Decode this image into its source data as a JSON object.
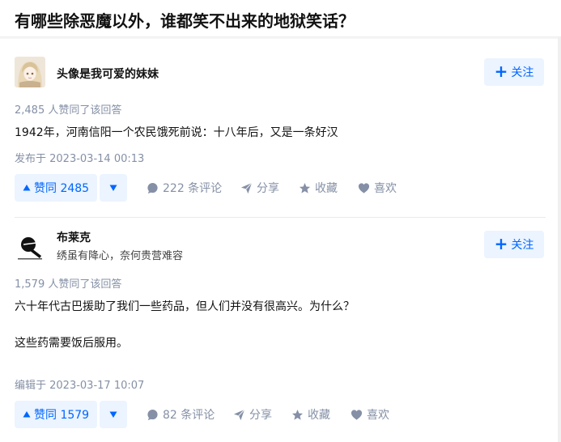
{
  "question": {
    "title": "有哪些除恶魔以外，谁都笑不出来的地狱笑话？"
  },
  "answers": [
    {
      "author": "头像是我可爱的妹妹",
      "bio": "",
      "follow_label": "关注",
      "vote_summary": "2,485 人赞同了该回答",
      "content": [
        "1942年，河南信阳一个农民饿死前说：十八年后，又是一条好汉"
      ],
      "time": "发布于 2023-03-14 00:13",
      "upvote_label": "赞同 2485",
      "comments_label": "222 条评论",
      "share_label": "分享",
      "collect_label": "收藏",
      "like_label": "喜欢"
    },
    {
      "author": "布莱克",
      "bio": "绣虽有降心，奈何贵营难容",
      "follow_label": "关注",
      "vote_summary": "1,579 人赞同了该回答",
      "content": [
        "六十年代古巴援助了我们一些药品，但人们并没有很高兴。为什么？",
        "这些药需要饭后服用。"
      ],
      "time": "编辑于 2023-03-17 10:07",
      "upvote_label": "赞同 1579",
      "comments_label": "82 条评论",
      "share_label": "分享",
      "collect_label": "收藏",
      "like_label": "喜欢"
    }
  ],
  "icons": {
    "plus": "plus-icon",
    "upvote": "triangle-up-icon",
    "downvote": "triangle-down-icon",
    "comment": "comment-bubble-icon",
    "share": "paper-plane-icon",
    "collect": "star-icon",
    "like": "heart-icon"
  },
  "colors": {
    "accent": "#0066ff",
    "accent_bg": "#ebf4ff",
    "muted": "#8590a6"
  }
}
